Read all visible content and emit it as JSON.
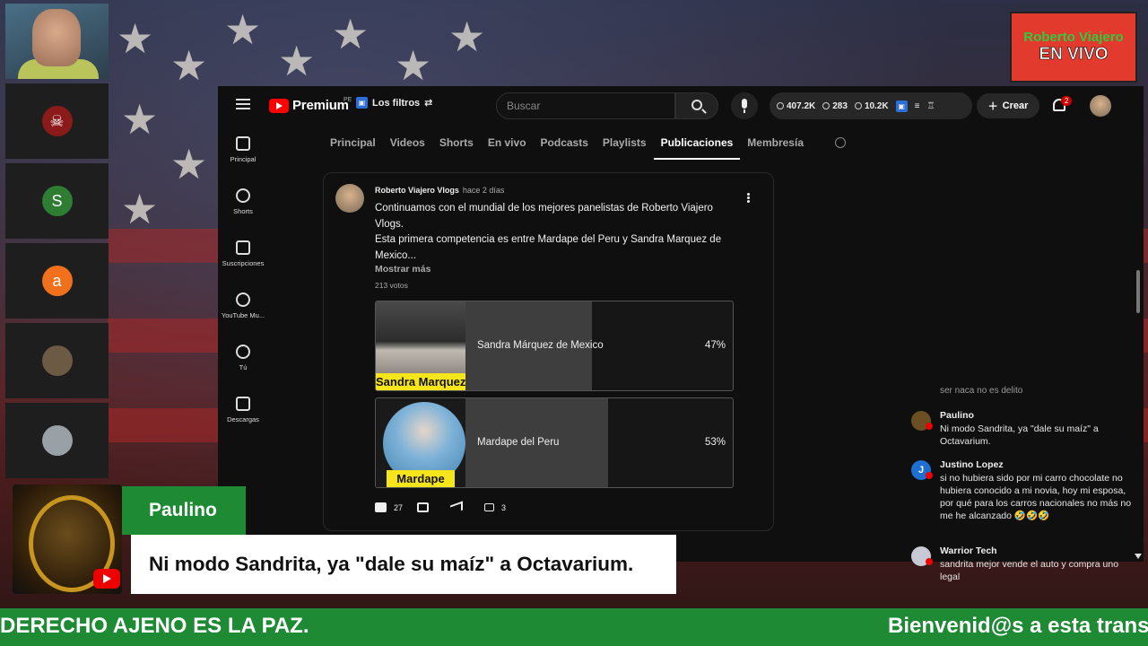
{
  "logo": {
    "line1": "Roberto Viajero",
    "line2": "EN VIVO"
  },
  "participants": [
    {
      "type": "camera"
    },
    {
      "type": "avatar",
      "color": "#8b1a1a",
      "letter": ""
    },
    {
      "type": "avatar",
      "color": "#2e7d32",
      "letter": "S"
    },
    {
      "type": "avatar",
      "color": "#f0701c",
      "letter": "a"
    },
    {
      "type": "avatar",
      "color": "#6d5a45",
      "letter": ""
    },
    {
      "type": "avatar",
      "color": "#9aa1a6",
      "letter": ""
    }
  ],
  "youtube": {
    "brand": "Premium",
    "brand_region": "PE",
    "filters_label": "Los filtros",
    "search_placeholder": "Buscar",
    "stats": {
      "views": "407.2K",
      "watching": "283",
      "likes": "10.2K"
    },
    "create_label": "Crear",
    "notif_count": "2",
    "sidebar": [
      "Principal",
      "Shorts",
      "Suscripciones",
      "YouTube Mu...",
      "Tú",
      "Descargas"
    ],
    "tabs": [
      "Principal",
      "Videos",
      "Shorts",
      "En vivo",
      "Podcasts",
      "Playlists",
      "Publicaciones",
      "Membresía"
    ],
    "active_tab": "Publicaciones",
    "post": {
      "author": "Roberto Viajero Vlogs",
      "time": "hace 2 días",
      "body": "Continuamos con el mundial de los mejores panelistas de Roberto Viajero Vlogs.\nEsta primera competencia es entre Mardape del Peru y Sandra Marquez de Mexico...",
      "more": "Mostrar más",
      "votes": "213 votos",
      "options": [
        {
          "label": "Sandra Márquez de Mexico",
          "percent": "47%",
          "fraction": 0.47,
          "tag": "Sandra Marquez"
        },
        {
          "label": "Mardape del Peru",
          "percent": "53%",
          "fraction": 0.53,
          "tag": "Mardape"
        }
      ],
      "likes": "27",
      "comments": "3"
    }
  },
  "chat": {
    "faded": "ser naca no es delito",
    "messages": [
      {
        "name": "Paulino",
        "text": "Ni modo Sandrita, ya \"dale su maíz\" a Octavarium.",
        "avatar_color": "#6b4f22",
        "letter": ""
      },
      {
        "name": "Justino Lopez",
        "text": "si no hubiera sido por mi carro chocolate no hubiera conocido a mi novia, hoy mi esposa, por qué para los carros nacionales no más no me he alcanzado 🤣🤣🤣",
        "avatar_color": "#1f6fd1",
        "letter": "J"
      },
      {
        "name": "Warrior Tech",
        "text": "sandrita mejor vende el auto y compra uno legal",
        "avatar_color": "#c9c9d6",
        "letter": ""
      }
    ]
  },
  "lower_third": {
    "name": "Paulino",
    "message": "Ni modo Sandrita, ya \"dale su maíz\" a Octavarium."
  },
  "ticker": {
    "left": "DERECHO AJENO ES LA PAZ.",
    "right": "Bienvenid@s a esta trans"
  }
}
